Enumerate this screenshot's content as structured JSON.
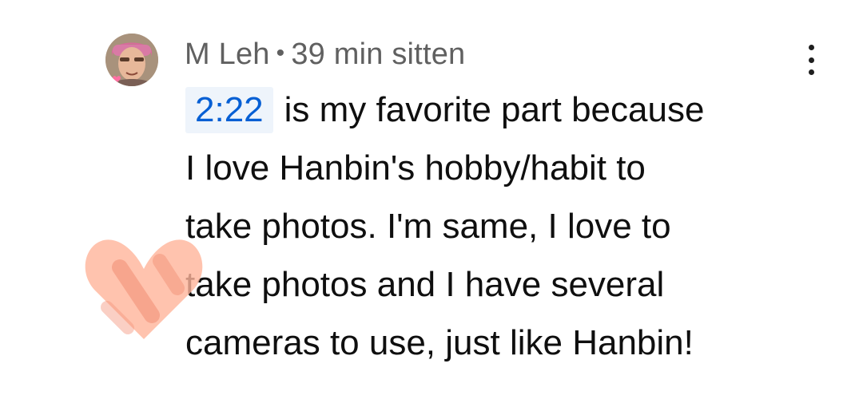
{
  "comment": {
    "author": "M Leh",
    "separator": "•",
    "time_ago": "39 min sitten",
    "timestamp_link": "2:22",
    "lines": [
      "is my favorite part because",
      "I love Hanbin's hobby/habit to",
      "take photos. I'm same, I love to",
      "take photos and I have several",
      "cameras to use, just like Hanbin!"
    ]
  },
  "icons": {
    "avatar": "user-avatar-photo",
    "menu": "more-vertical-icon",
    "overlay": "heart-sticker-icon"
  },
  "colors": {
    "author_meta": "#606060",
    "body_text": "#0f0f0f",
    "timestamp_link": "#065fd4",
    "timestamp_bg": "#eef4fb",
    "heart_overlay": "#ff9a7a"
  }
}
